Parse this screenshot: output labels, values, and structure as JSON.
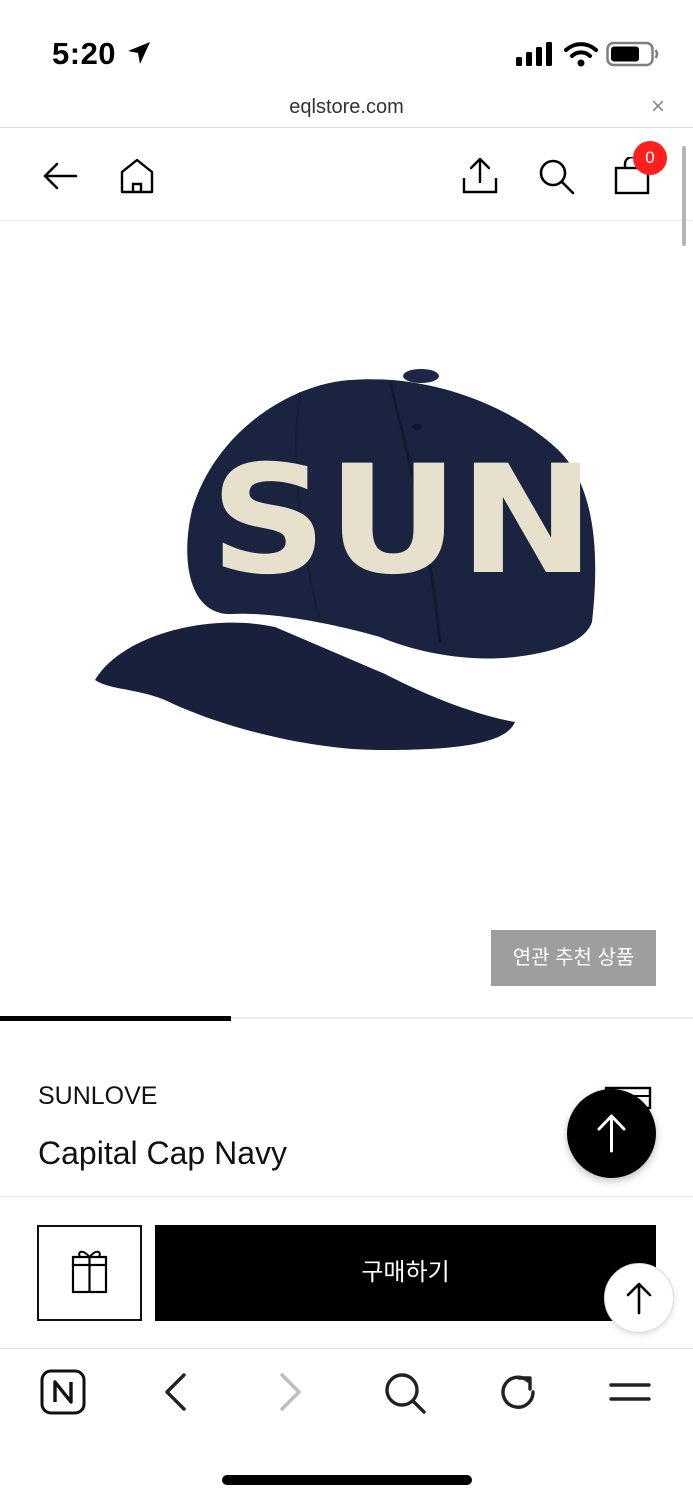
{
  "status_bar": {
    "time": "5:20"
  },
  "browser": {
    "url": "eqlstore.com",
    "close_glyph": "×"
  },
  "header": {
    "cart_count": "0"
  },
  "product": {
    "image_lettering": "SUN",
    "related_label": "연관 추천 상품",
    "gallery_progress": 0.333,
    "brand": "SUNLOVE",
    "name": "Capital Cap Navy"
  },
  "actions": {
    "buy_label": "구매하기"
  },
  "colors": {
    "cap_navy": "#1a2340",
    "cap_lettering": "#e6e0cc",
    "badge_red": "#ff1f1f",
    "related_button_gray": "#9e9e9e"
  },
  "icons": {
    "header": [
      "back-arrow-icon",
      "home-icon",
      "share-icon",
      "search-icon",
      "cart-icon"
    ],
    "toolbar": [
      "naver-logo-icon",
      "chevron-left-icon",
      "chevron-right-icon",
      "search-icon",
      "refresh-icon",
      "menu-icon"
    ]
  }
}
